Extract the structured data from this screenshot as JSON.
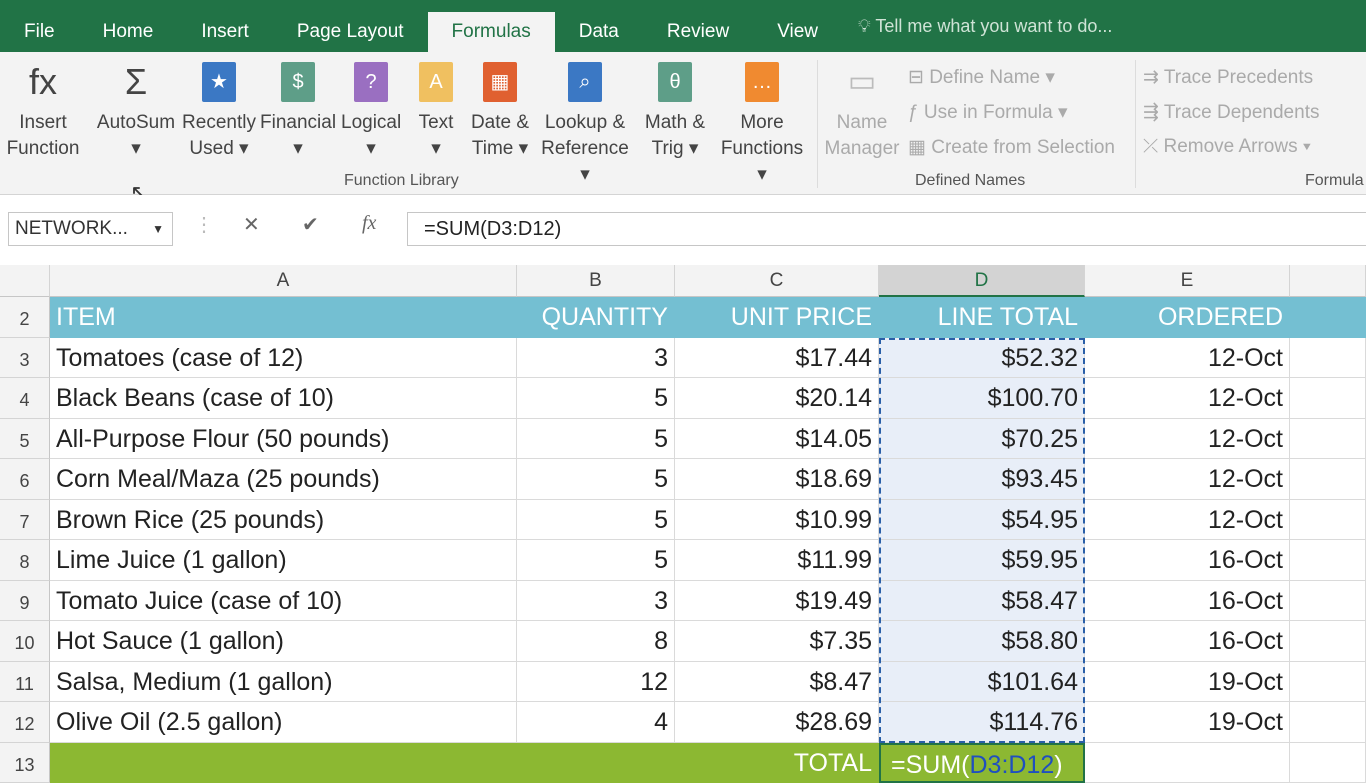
{
  "tabs": [
    "File",
    "Home",
    "Insert",
    "Page Layout",
    "Formulas",
    "Data",
    "Review",
    "View"
  ],
  "active_tab": "Formulas",
  "tell_me": "Tell me what you want to do...",
  "ribbon": {
    "function_library": [
      {
        "l1": "Insert",
        "l2": "Function",
        "icon": "fx-icon",
        "color": "",
        "glyph": "fx"
      },
      {
        "l1": "AutoSum",
        "l2": "▾",
        "icon": "sigma-icon",
        "color": "",
        "glyph": "Σ"
      },
      {
        "l1": "Recently",
        "l2": "Used ▾",
        "icon": "star-book-icon",
        "color": "#3b78c4",
        "glyph": "★"
      },
      {
        "l1": "Financial",
        "l2": "▾",
        "icon": "coins-book-icon",
        "color": "#5e9e88",
        "glyph": "$"
      },
      {
        "l1": "Logical",
        "l2": "▾",
        "icon": "question-book-icon",
        "color": "#9a6fc1",
        "glyph": "?"
      },
      {
        "l1": "Text",
        "l2": "▾",
        "icon": "text-book-icon",
        "color": "#f0c060",
        "glyph": "A"
      },
      {
        "l1": "Date &",
        "l2": "Time ▾",
        "icon": "calendar-book-icon",
        "color": "#e06030",
        "glyph": "▦"
      },
      {
        "l1": "Lookup &",
        "l2": "Reference ▾",
        "icon": "magnifier-book-icon",
        "color": "#3b78c4",
        "glyph": "⌕"
      },
      {
        "l1": "Math &",
        "l2": "Trig ▾",
        "icon": "theta-book-icon",
        "color": "#5e9e88",
        "glyph": "θ"
      },
      {
        "l1": "More",
        "l2": "Functions ▾",
        "icon": "more-book-icon",
        "color": "#f08a30",
        "glyph": "…"
      }
    ],
    "function_library_label": "Function Library",
    "name_manager": [
      "Name",
      "Manager"
    ],
    "define_name": "Define Name ▾",
    "use_in_formula": "Use in Formula ▾",
    "create_from_selection": "Create from Selection",
    "defined_names_label": "Defined Names",
    "trace_precedents": "Trace Precedents",
    "trace_dependents": "Trace Dependents",
    "remove_arrows": "Remove Arrows ▾",
    "formula_auditing_label": "Formula"
  },
  "name_box": "NETWORK...",
  "formula": "=SUM(D3:D12)",
  "columns": [
    "A",
    "B",
    "C",
    "D",
    "E"
  ],
  "header_row": {
    "num": "2",
    "cells": [
      "ITEM",
      "QUANTITY",
      "UNIT PRICE",
      "LINE TOTAL",
      "ORDERED"
    ]
  },
  "rows": [
    {
      "num": "3",
      "cells": [
        "Tomatoes (case of 12)",
        "3",
        "$17.44",
        "$52.32",
        "12-Oct"
      ]
    },
    {
      "num": "4",
      "cells": [
        "Black Beans (case of 10)",
        "5",
        "$20.14",
        "$100.70",
        "12-Oct"
      ]
    },
    {
      "num": "5",
      "cells": [
        "All-Purpose Flour (50 pounds)",
        "5",
        "$14.05",
        "$70.25",
        "12-Oct"
      ]
    },
    {
      "num": "6",
      "cells": [
        "Corn Meal/Maza (25 pounds)",
        "5",
        "$18.69",
        "$93.45",
        "12-Oct"
      ]
    },
    {
      "num": "7",
      "cells": [
        "Brown Rice (25 pounds)",
        "5",
        "$10.99",
        "$54.95",
        "12-Oct"
      ]
    },
    {
      "num": "8",
      "cells": [
        "Lime Juice (1 gallon)",
        "5",
        "$11.99",
        "$59.95",
        "16-Oct"
      ]
    },
    {
      "num": "9",
      "cells": [
        "Tomato Juice (case of 10)",
        "3",
        "$19.49",
        "$58.47",
        "16-Oct"
      ]
    },
    {
      "num": "10",
      "cells": [
        "Hot Sauce (1 gallon)",
        "8",
        "$7.35",
        "$58.80",
        "16-Oct"
      ]
    },
    {
      "num": "11",
      "cells": [
        "Salsa, Medium (1 gallon)",
        "12",
        "$8.47",
        "$101.64",
        "19-Oct"
      ]
    },
    {
      "num": "12",
      "cells": [
        "Olive Oil (2.5 gallon)",
        "4",
        "$28.69",
        "$114.76",
        "19-Oct"
      ]
    }
  ],
  "total_row": {
    "num": "13",
    "label": "TOTAL",
    "formula_pre": "=SUM(",
    "formula_ref": "D3:D12",
    "formula_post": ")"
  },
  "colors": {
    "accent": "#217346",
    "header_fill": "#74bfd2",
    "total_fill": "#8cb832",
    "selection": "#e8eef8"
  }
}
